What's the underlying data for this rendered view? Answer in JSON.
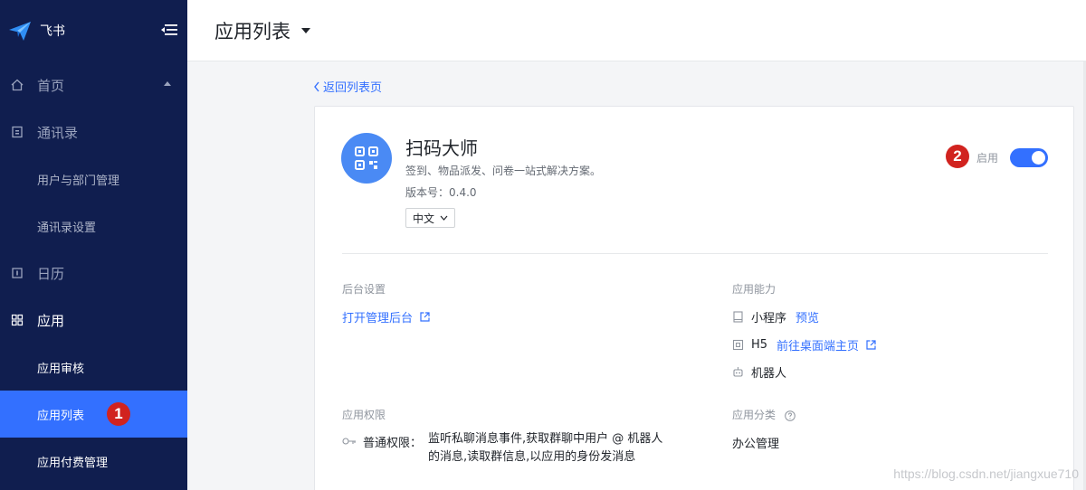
{
  "brand": {
    "name": "飞书"
  },
  "sidebar": {
    "items": [
      {
        "label": "首页",
        "icon": "home-icon"
      },
      {
        "label": "通讯录",
        "icon": "contacts-icon"
      },
      {
        "label": "用户与部门管理"
      },
      {
        "label": "通讯录设置"
      },
      {
        "label": "日历",
        "icon": "calendar-icon"
      },
      {
        "label": "应用",
        "icon": "apps-grid-icon"
      },
      {
        "label": "应用审核"
      },
      {
        "label": "应用列表"
      },
      {
        "label": "应用付费管理"
      }
    ],
    "selected": "应用列表"
  },
  "annotations": {
    "badge1": "1",
    "badge2": "2"
  },
  "header": {
    "title": "应用列表"
  },
  "back_link": "返回列表页",
  "app": {
    "name": "扫码大师",
    "description": "签到、物品派发、问卷一站式解决方案。",
    "version": "版本号：0.4.0",
    "language": "中文",
    "enable_label": "启用",
    "enabled": true
  },
  "backend": {
    "title": "后台设置",
    "link": "打开管理后台"
  },
  "capabilities": {
    "title": "应用能力",
    "mini_program": {
      "label": "小程序",
      "link": "预览"
    },
    "h5": {
      "label": "H5",
      "link": "前往桌面端主页"
    },
    "bot": {
      "label": "机器人"
    }
  },
  "permissions": {
    "title": "应用权限",
    "label": "普通权限：",
    "text": "监听私聊消息事件,获取群聊中用户 @ 机器人的消息,读取群信息,以应用的身份发消息"
  },
  "category": {
    "title": "应用分类",
    "value": "办公管理"
  },
  "watermark": "https://blog.csdn.net/jiangxue710",
  "colors": {
    "sidebar_bg": "#101e4f",
    "accent": "#3370ff",
    "badge": "#d1231f"
  }
}
